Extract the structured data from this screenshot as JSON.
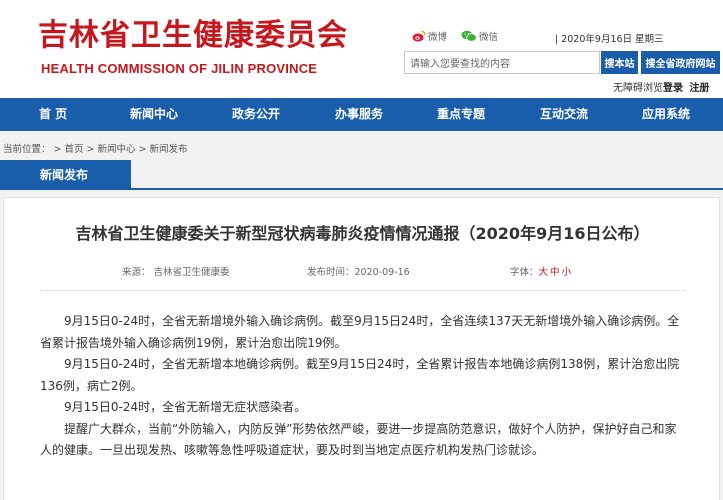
{
  "header": {
    "logo_cn": "吉林省卫生健康委员会",
    "logo_en": "HEALTH COMMISSION OF JILIN PROVINCE",
    "weibo": "微博",
    "wechat": "微信",
    "date": "| 2020年9月16日 星期三",
    "search_placeholder": "请输入您要查找的内容",
    "search_site_btn": "搜本站",
    "search_all_btn": "搜全省政府网站",
    "accessibility": "无障碍浏览",
    "login": "登录",
    "register": "注册"
  },
  "nav": {
    "items": [
      "首 页",
      "新闻中心",
      "政务公开",
      "办事服务",
      "重点专题",
      "互动交流",
      "应用系统"
    ]
  },
  "breadcrumb": {
    "prefix": "当前位置：",
    "items": [
      "首页",
      "新闻中心",
      "新闻发布"
    ],
    "sep": ">"
  },
  "section_tab": "新闻发布",
  "article": {
    "title": "吉林省卫生健康委关于新型冠状病毒肺炎疫情情况通报（2020年9月16日公布）",
    "source": "来源：  吉林省卫生健康委",
    "published": "发布时间：2020-09-16",
    "font_label": "字体：",
    "font_sizes": [
      "大",
      "中",
      "小"
    ],
    "paragraphs": [
      "9月15日0-24时，全省无新增境外输入确诊病例。截至9月15日24时，全省连续137天无新增境外输入确诊病例。全省累计报告境外输入确诊病例19例，累计治愈出院19例。",
      "9月15日0-24时，全省无新增本地确诊病例。截至9月15日24时，全省累计报告本地确诊病例138例，累计治愈出院136例，病亡2例。",
      "9月15日0-24时，全省无新增无症状感染者。",
      "提醒广大群众，当前“外防输入，内防反弹”形势依然严峻，要进一步提高防范意识，做好个人防护，保护好自己和家人的健康。一旦出现发热、咳嗽等急性呼吸道症状，要及时到当地定点医疗机构发热门诊就诊。"
    ]
  },
  "colors": {
    "brand_red": "#c8161d",
    "nav_blue": "#1a5daa"
  },
  "icons": [
    "weibo-icon",
    "wechat-icon"
  ]
}
